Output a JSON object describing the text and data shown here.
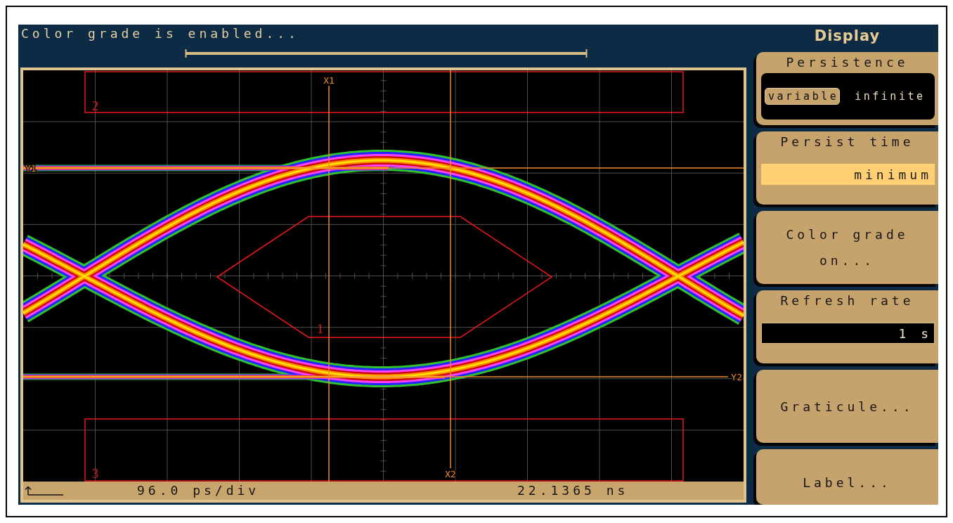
{
  "status_message": "Color grade is enabled...",
  "waveform": {
    "markers": [
      {
        "label": "X1",
        "kind": "vertical"
      },
      {
        "label": "X2",
        "kind": "vertical"
      },
      {
        "label": "Y1",
        "kind": "horizontal"
      },
      {
        "label": "Y2",
        "kind": "horizontal"
      }
    ],
    "mask_regions": [
      {
        "label": "2",
        "kind": "rectangle"
      },
      {
        "label": "1",
        "kind": "hexagon"
      },
      {
        "label": "3",
        "kind": "rectangle"
      }
    ],
    "time_scale": "96.0 ps/div",
    "time_reading": "22.1365 ns"
  },
  "menu": {
    "title": "Display",
    "controls": [
      {
        "kind": "toggle",
        "label": "Persistence",
        "options": [
          {
            "label": "variable",
            "selected": true
          },
          {
            "label": "infinite",
            "selected": false
          }
        ]
      },
      {
        "kind": "field",
        "label": "Persist time",
        "value": "minimum",
        "active": true
      },
      {
        "kind": "button",
        "label": "Color grade on..."
      },
      {
        "kind": "field",
        "label": "Refresh rate",
        "value": "1 s",
        "active": false
      },
      {
        "kind": "button",
        "label": "Graticule..."
      },
      {
        "kind": "button",
        "label": "Label..."
      }
    ]
  }
}
